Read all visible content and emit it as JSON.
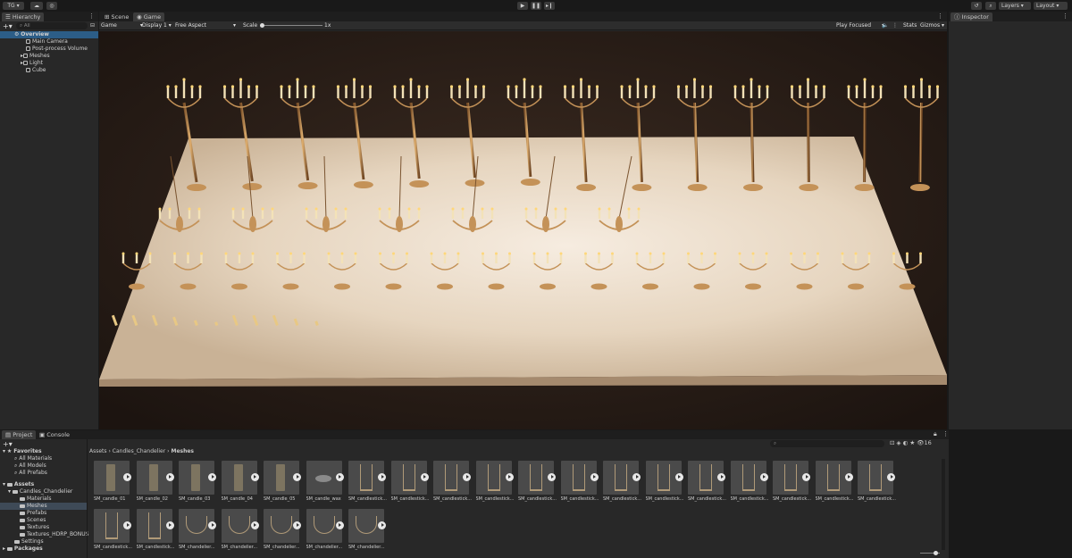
{
  "toolbar": {
    "account": "TG",
    "layers": "Layers",
    "layout": "Layout"
  },
  "hierarchy": {
    "tab": "Hierarchy",
    "search_placeholder": "All",
    "root": "Overview",
    "items": [
      "Main Camera",
      "Post-process Volume",
      "Meshes",
      "Light",
      "Cube"
    ]
  },
  "scene_tabs": [
    "Scene",
    "Game"
  ],
  "game_bar": {
    "mode": "Game",
    "display": "Display 1",
    "aspect": "Free Aspect",
    "scale_label": "Scale",
    "scale_value": "1x",
    "play_mode": "Play Focused",
    "stats": "Stats",
    "gizmos": "Gizmos"
  },
  "inspector": {
    "tab": "Inspector"
  },
  "project": {
    "tabs": [
      "Project",
      "Console"
    ],
    "count": "16",
    "favorites": {
      "label": "Favorites",
      "items": [
        "All Materials",
        "All Models",
        "All Prefabs"
      ]
    },
    "assets": {
      "label": "Assets",
      "folder": "Candles_Chandelier",
      "children": [
        "Materials",
        "Meshes",
        "Prefabs",
        "Scenes",
        "Textures",
        "Textures_HDRP_BONUS"
      ],
      "settings": "Settings"
    },
    "packages": "Packages",
    "breadcrumb": [
      "Assets",
      "Candles_Chandelier",
      "Meshes"
    ],
    "files": [
      "SM_candle_01",
      "SM_candle_02",
      "SM_candle_03",
      "SM_candle_04",
      "SM_candle_05",
      "SM_candle_wax",
      "SM_candlestick...",
      "SM_candlestick...",
      "SM_candlestick...",
      "SM_candlestick...",
      "SM_candlestick...",
      "SM_candlestick...",
      "SM_candlestick...",
      "SM_candlestick...",
      "SM_candlestick...",
      "SM_candlestick...",
      "SM_candlestick...",
      "SM_candlestick...",
      "SM_candlestick...",
      "SM_candlestick...",
      "SM_candlestick...",
      "SM_chandelier...",
      "SM_chandelier...",
      "SM_chandelier...",
      "SM_chandelier...",
      "SM_chandelier..."
    ]
  },
  "colors": {
    "accent": "#3a72b0",
    "panel": "#282828",
    "viewport_bg": "#241915",
    "floor": "#e8dccb",
    "gold": "#c49258"
  }
}
